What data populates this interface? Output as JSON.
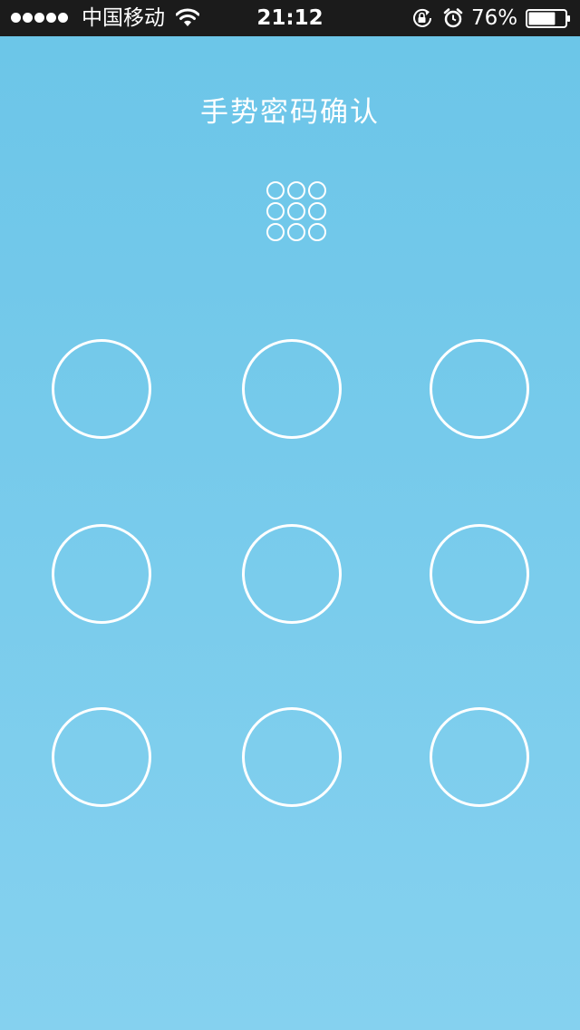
{
  "status_bar": {
    "signal_icon": "signal-dots-icon",
    "signal_bars": 5,
    "carrier": "中国移动",
    "wifi_icon": "wifi-icon",
    "time": "21:12",
    "rotation_lock_icon": "rotation-lock-icon",
    "alarm_icon": "alarm-icon",
    "battery_percent": "76%",
    "battery_level": 0.76,
    "battery_icon": "battery-icon"
  },
  "title": "手势密码确认",
  "preview": {
    "icon": "gesture-preview-grid",
    "rows": 3,
    "cols": 3,
    "selected": []
  },
  "gesture_grid": {
    "rows": 3,
    "cols": 3,
    "selected": []
  },
  "colors": {
    "background_top": "#6bc5e8",
    "background_bottom": "#85d1ef",
    "status_bar": "#1b1b1b",
    "circle_stroke": "#ffffff"
  }
}
